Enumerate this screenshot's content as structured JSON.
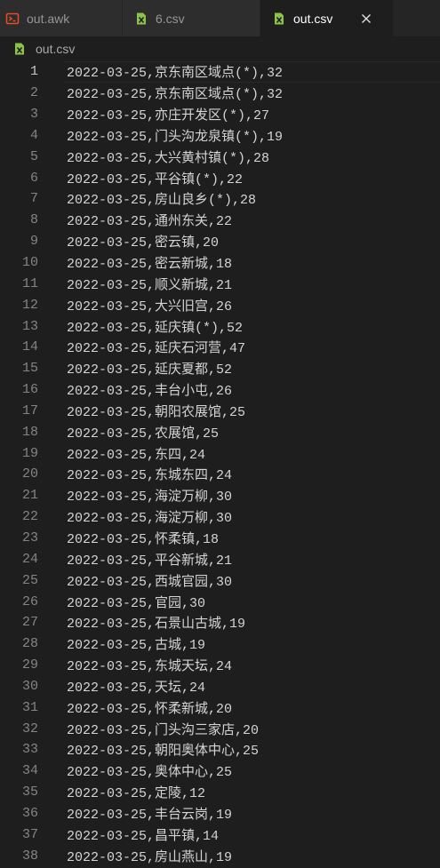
{
  "tabs": [
    {
      "label": "out.awk",
      "icon": "terminal-file-icon",
      "active": false
    },
    {
      "label": "6.csv",
      "icon": "spreadsheet-file-icon",
      "active": false
    },
    {
      "label": "out.csv",
      "icon": "spreadsheet-file-icon",
      "active": true
    }
  ],
  "breadcrumb": {
    "label": "out.csv",
    "icon": "spreadsheet-file-icon"
  },
  "colors": {
    "editor_bg": "#1e1e1e",
    "tabbar_bg": "#252526",
    "inactive_tab_bg": "#2d2d2d",
    "awk_icon": "#e44d26",
    "csv_icon": "#8bc34a",
    "line_number": "#858585",
    "text": "#d4d4d4"
  },
  "lines": [
    {
      "num": "1",
      "text": "2022-03-25,京东南区域点(*),32"
    },
    {
      "num": "2",
      "text": "2022-03-25,京东南区域点(*),32"
    },
    {
      "num": "3",
      "text": "2022-03-25,亦庄开发区(*),27"
    },
    {
      "num": "4",
      "text": "2022-03-25,门头沟龙泉镇(*),19"
    },
    {
      "num": "5",
      "text": "2022-03-25,大兴黄村镇(*),28"
    },
    {
      "num": "6",
      "text": "2022-03-25,平谷镇(*),22"
    },
    {
      "num": "7",
      "text": "2022-03-25,房山良乡(*),28"
    },
    {
      "num": "8",
      "text": "2022-03-25,通州东关,22"
    },
    {
      "num": "9",
      "text": "2022-03-25,密云镇,20"
    },
    {
      "num": "10",
      "text": "2022-03-25,密云新城,18"
    },
    {
      "num": "11",
      "text": "2022-03-25,顺义新城,21"
    },
    {
      "num": "12",
      "text": "2022-03-25,大兴旧宫,26"
    },
    {
      "num": "13",
      "text": "2022-03-25,延庆镇(*),52"
    },
    {
      "num": "14",
      "text": "2022-03-25,延庆石河营,47"
    },
    {
      "num": "15",
      "text": "2022-03-25,延庆夏都,52"
    },
    {
      "num": "16",
      "text": "2022-03-25,丰台小屯,26"
    },
    {
      "num": "17",
      "text": "2022-03-25,朝阳农展馆,25"
    },
    {
      "num": "18",
      "text": "2022-03-25,农展馆,25"
    },
    {
      "num": "19",
      "text": "2022-03-25,东四,24"
    },
    {
      "num": "20",
      "text": "2022-03-25,东城东四,24"
    },
    {
      "num": "21",
      "text": "2022-03-25,海淀万柳,30"
    },
    {
      "num": "22",
      "text": "2022-03-25,海淀万柳,30"
    },
    {
      "num": "23",
      "text": "2022-03-25,怀柔镇,18"
    },
    {
      "num": "24",
      "text": "2022-03-25,平谷新城,21"
    },
    {
      "num": "25",
      "text": "2022-03-25,西城官园,30"
    },
    {
      "num": "26",
      "text": "2022-03-25,官园,30"
    },
    {
      "num": "27",
      "text": "2022-03-25,石景山古城,19"
    },
    {
      "num": "28",
      "text": "2022-03-25,古城,19"
    },
    {
      "num": "29",
      "text": "2022-03-25,东城天坛,24"
    },
    {
      "num": "30",
      "text": "2022-03-25,天坛,24"
    },
    {
      "num": "31",
      "text": "2022-03-25,怀柔新城,20"
    },
    {
      "num": "32",
      "text": "2022-03-25,门头沟三家店,20"
    },
    {
      "num": "33",
      "text": "2022-03-25,朝阳奥体中心,25"
    },
    {
      "num": "34",
      "text": "2022-03-25,奥体中心,25"
    },
    {
      "num": "35",
      "text": "2022-03-25,定陵,12"
    },
    {
      "num": "36",
      "text": "2022-03-25,丰台云岗,19"
    },
    {
      "num": "37",
      "text": "2022-03-25,昌平镇,14"
    },
    {
      "num": "38",
      "text": "2022-03-25,房山燕山,19"
    }
  ]
}
